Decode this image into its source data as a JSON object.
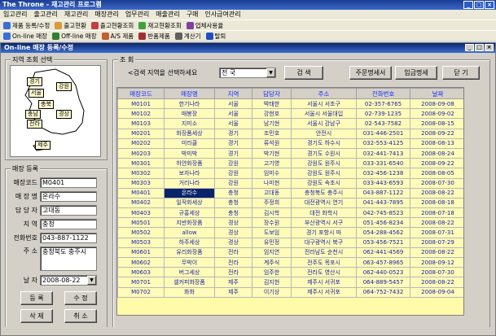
{
  "app": {
    "title": "The Throne - 재고관리 프로그램"
  },
  "menubar": [
    "입고관리",
    "출고관리",
    "재고관리",
    "매장관리",
    "업무관리",
    "매출관리",
    "구매",
    "인사급여관리"
  ],
  "toolbar_row1": [
    {
      "label": "제품 등록/수정",
      "icon": "product-register-icon",
      "color": "#3a6fd8"
    },
    {
      "label": "출고현황",
      "icon": "outbound-status-icon",
      "color": "#d89a3a"
    },
    {
      "label": "출고현황조회",
      "icon": "outbound-query-icon",
      "color": "#c04040"
    },
    {
      "label": "재고현황조회",
      "icon": "stock-query-icon",
      "color": "#40a040"
    },
    {
      "label": "업체사용율",
      "icon": "vendor-rate-icon",
      "color": "#8040a0"
    }
  ],
  "toolbar_row2": [
    {
      "label": "On-line 매장",
      "icon": "online-store-icon",
      "color": "#3a6fd8"
    },
    {
      "label": "Off-line 매장",
      "icon": "offline-store-icon",
      "color": "#308030"
    },
    {
      "label": "A/S 제품",
      "icon": "as-product-icon",
      "color": "#c06030"
    },
    {
      "label": "반품제품",
      "icon": "returned-product-icon",
      "color": "#a03030"
    },
    {
      "label": "계산기",
      "icon": "calculator-icon",
      "color": "#606060"
    },
    {
      "label": "탈퇴",
      "icon": "exit-icon",
      "color": "#2050c0"
    }
  ],
  "window": {
    "title": "On-line 매장 등록/수정"
  },
  "region_panel": {
    "label": "지역 조회 선택",
    "regions": [
      "경기",
      "서울",
      "강원",
      "충북",
      "충남",
      "전라",
      "경상",
      "제주"
    ]
  },
  "store_reg": {
    "label": "매장 등록",
    "fields": [
      {
        "label": "매장코드",
        "value": "M0401"
      },
      {
        "label": "매 장 명",
        "value": "온라수"
      },
      {
        "label": "담 당 자",
        "value": "고대동"
      },
      {
        "label": "지 역",
        "value": "충청"
      },
      {
        "label": "전화번호",
        "value": "043-887-1122"
      },
      {
        "label": "주 소",
        "value": "충청북도 충주시"
      }
    ],
    "date_label": "날 자",
    "date_value": "2008-08-22",
    "buttons": {
      "register": "등 록",
      "edit": "수 정",
      "delete": "삭 제",
      "cancel": "취 소"
    }
  },
  "query": {
    "label": "조 회",
    "prompt": "<검색 지역을 선택하세요",
    "region_value": "전 국",
    "search_button": "검 색",
    "order_button": "주문명세서",
    "sales_button": "입금명세",
    "close_button": "닫 기"
  },
  "table": {
    "columns": [
      "매장코드",
      "매장명",
      "지역",
      "담당자",
      "주소",
      "전화번호",
      "날짜"
    ],
    "rows": [
      [
        "M0101",
        "한기나라",
        "서울",
        "박태한",
        "서울시 서초구",
        "02-357-6765",
        "2008-09-08"
      ],
      [
        "M0102",
        "매봉장",
        "서울",
        "강현호",
        "서울시 서울대입",
        "02-739-1235",
        "2008-09-02"
      ],
      [
        "M0103",
        "지미소",
        "서울",
        "남기현",
        "서울시 강남구",
        "02-543-7582",
        "2008-08-15"
      ],
      [
        "M0201",
        "화장품세상",
        "경기",
        "조민호",
        "안전시",
        "031-446-2501",
        "2008-09-22"
      ],
      [
        "M0202",
        "미라클",
        "경기",
        "류석원",
        "경기도 하수시",
        "032-553-4125",
        "2008-08-13"
      ],
      [
        "M0203",
        "박미박",
        "경기",
        "박기현",
        "경기도 수원시",
        "032-441-7413",
        "2008-08-24"
      ],
      [
        "M0301",
        "하얀화장품",
        "강원",
        "고기영",
        "강원도 원주시",
        "033-331-6540",
        "2008-09-22"
      ],
      [
        "M0302",
        "보자나라",
        "강원",
        "임미수",
        "강원도 원주시",
        "032-456-1238",
        "2008-08-05"
      ],
      [
        "M0303",
        "거리나라",
        "강원",
        "나미현",
        "강원도 속초시",
        "033-443-6593",
        "2008-07-30"
      ],
      [
        "M0401",
        "온라수",
        "충청",
        "고대동",
        "충청북도 충주시",
        "043-887-1122",
        "2008-08-22"
      ],
      [
        "M0402",
        "일작화세상",
        "충청",
        "주정희",
        "대전광역시 연기",
        "041-443-7895",
        "2008-08-18"
      ],
      [
        "M0403",
        "규홍세상",
        "충청",
        "김시학",
        "대전 화학시",
        "042-745-8523",
        "2008-07-18"
      ],
      [
        "M0501",
        "지반화장품",
        "경상",
        "장수원",
        "부산광역시 서구",
        "051-456-8234",
        "2008-08-22"
      ],
      [
        "M0502",
        "allow",
        "경상",
        "도보임",
        "경기 포항시 마",
        "054-288-4562",
        "2008-07-31"
      ],
      [
        "M0503",
        "하주세상",
        "경상",
        "유민정",
        "대구광역시 북구",
        "053-456-7521",
        "2008-07-29"
      ],
      [
        "M0601",
        "유리화장품",
        "전라",
        "임지연",
        "전라남도 순천시",
        "062-441-4569",
        "2008-08-22"
      ],
      [
        "M0602",
        "무박이",
        "전라",
        "계주식",
        "전주도 목포시",
        "063-457-8965",
        "2008-09-12"
      ],
      [
        "M0603",
        "버그세상",
        "전라",
        "임주한",
        "전라도 영산시",
        "062-440-0523",
        "2008-07-30"
      ],
      [
        "M0701",
        "셀커피화장품",
        "제주",
        "김지현",
        "제주시 서귀포",
        "064-889-5457",
        "2008-08-22"
      ],
      [
        "M0702",
        "화화",
        "제주",
        "이기상",
        "제주시 서귀포",
        "064-752-7432",
        "2008-09-04"
      ]
    ],
    "selected_row": 9
  }
}
